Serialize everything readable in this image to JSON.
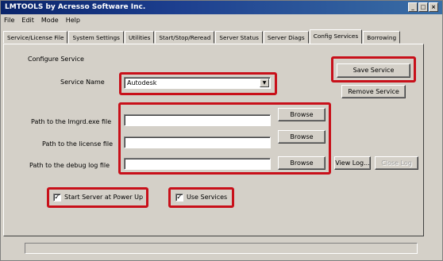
{
  "window": {
    "title": "LMTOOLS by Acresso Software Inc.",
    "minimize_glyph": "_",
    "maximize_glyph": "□",
    "close_glyph": "×"
  },
  "menu": [
    "File",
    "Edit",
    "Mode",
    "Help"
  ],
  "tabs": [
    {
      "label": "Service/License File",
      "active": false
    },
    {
      "label": "System Settings",
      "active": false
    },
    {
      "label": "Utilities",
      "active": false
    },
    {
      "label": "Start/Stop/Reread",
      "active": false
    },
    {
      "label": "Server Status",
      "active": false
    },
    {
      "label": "Server Diags",
      "active": false
    },
    {
      "label": "Config Services",
      "active": true
    },
    {
      "label": "Borrowing",
      "active": false
    }
  ],
  "config": {
    "section_label": "Configure Service",
    "service_name_label": "Service Name",
    "service_name_value": "Autodesk",
    "save_button": "Save Service",
    "remove_button": "Remove Service",
    "lmgrd_label": "Path to the lmgrd.exe file",
    "license_label": "Path to the license file",
    "debug_label": "Path to the debug log file",
    "lmgrd_value": "",
    "license_value": "",
    "debug_value": "",
    "browse_label": "Browse",
    "view_log_button": "View Log...",
    "close_log_button": "Close Log",
    "start_server_label": "Start Server at Power Up",
    "start_server_checked": true,
    "use_services_label": "Use Services",
    "use_services_checked": true
  },
  "status": {
    "text": ""
  },
  "colors": {
    "highlight": "#c8101a",
    "title_bar": "#0a246a",
    "face": "#d4d0c8"
  }
}
